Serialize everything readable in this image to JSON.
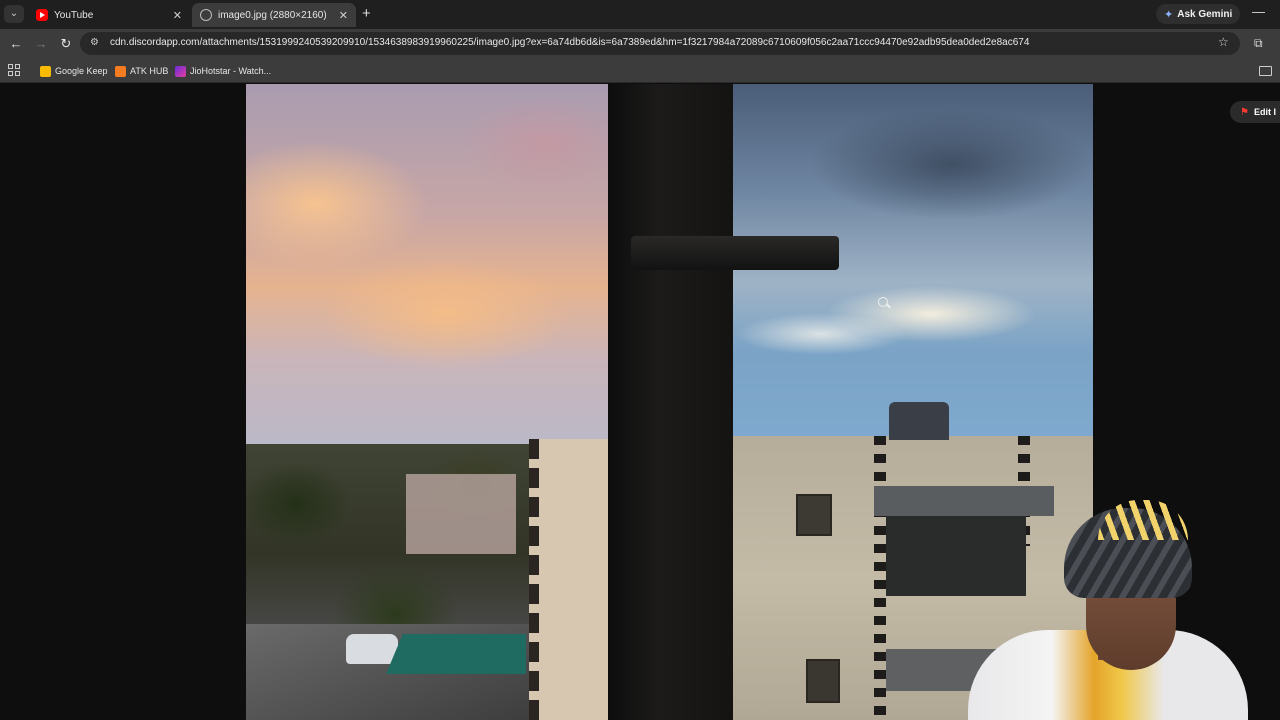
{
  "tabs": [
    {
      "title": "YouTube",
      "active": false,
      "icon": "youtube-icon"
    },
    {
      "title": "image0.jpg (2880×2160)",
      "active": true,
      "icon": "globe-icon"
    }
  ],
  "toolbar": {
    "url": "cdn.discordapp.com/attachments/1531999240539209910/1534638983919960225/image0.jpg?ex=6a74db6d&is=6a7389ed&hm=1f3217984a72089c6710609f056c2aa71ccc94470e92adb95dea0ded2e8ac674",
    "gemini_label": "Ask Gemini"
  },
  "bookmarks": [
    {
      "label": "Google Keep",
      "icon": "keep-icon"
    },
    {
      "label": "ATK HUB",
      "icon": "atk-icon"
    },
    {
      "label": "JioHotstar - Watch...",
      "icon": "jio-icon"
    }
  ],
  "viewer": {
    "edit_label": "Edit I"
  },
  "colors": {
    "tabstrip": "#1f1f1f",
    "toolbar": "#3c3c3c",
    "omnibox": "#282828",
    "accent": "#8ab4f8",
    "pdf_red": "#ff3b30"
  }
}
